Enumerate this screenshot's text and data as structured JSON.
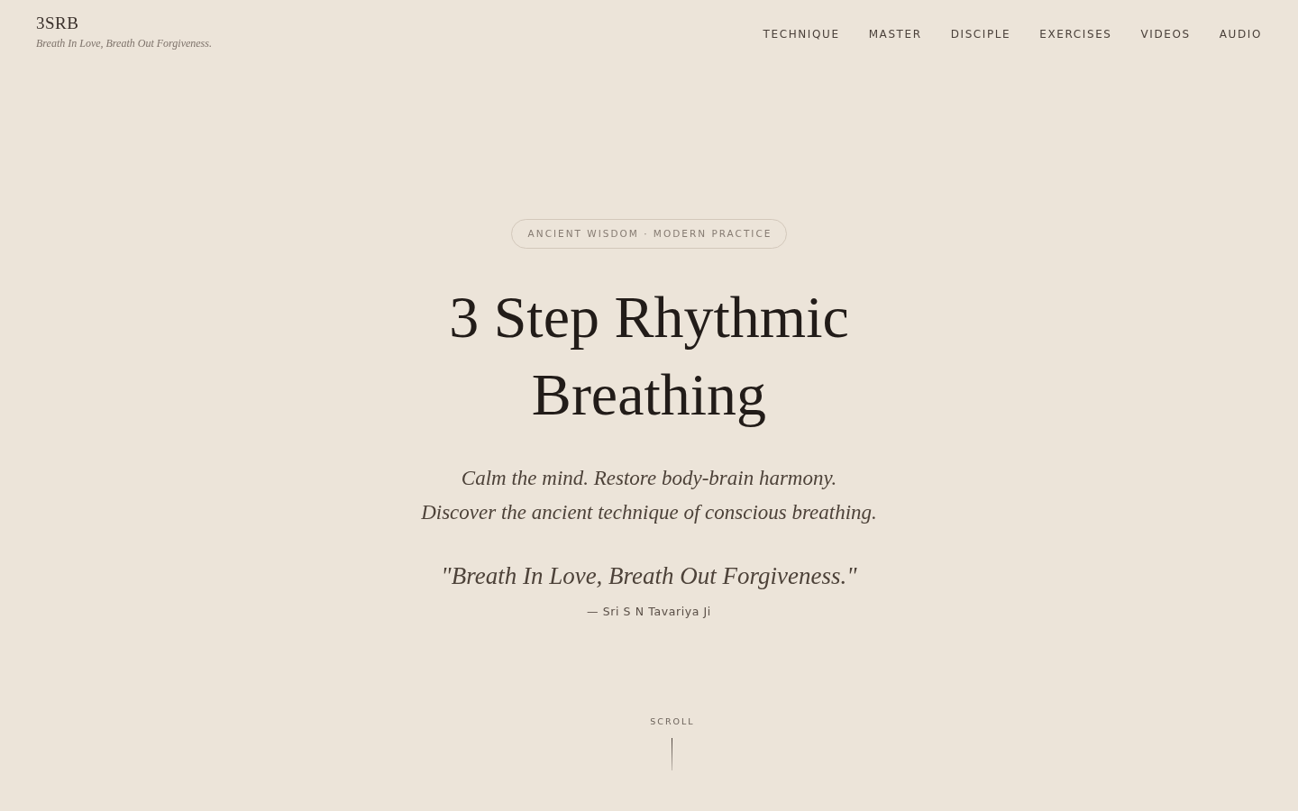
{
  "header": {
    "logo": "3SRB",
    "tagline": "Breath In Love, Breath Out Forgiveness.",
    "nav": [
      "TECHNIQUE",
      "MASTER",
      "DISCIPLE",
      "EXERCISES",
      "VIDEOS",
      "AUDIO"
    ]
  },
  "hero": {
    "badge": "ANCIENT WISDOM · MODERN PRACTICE",
    "title": "3 Step Rhythmic Breathing",
    "subtitle_lines": [
      "Calm the mind. Restore body-brain harmony.",
      "Discover the ancient technique of conscious breathing."
    ],
    "quote": "\"Breath In Love, Breath Out Forgiveness.\"",
    "attribution": "— Sri S N Tavariya Ji"
  },
  "scroll_cue": {
    "label": "SCROLL"
  }
}
